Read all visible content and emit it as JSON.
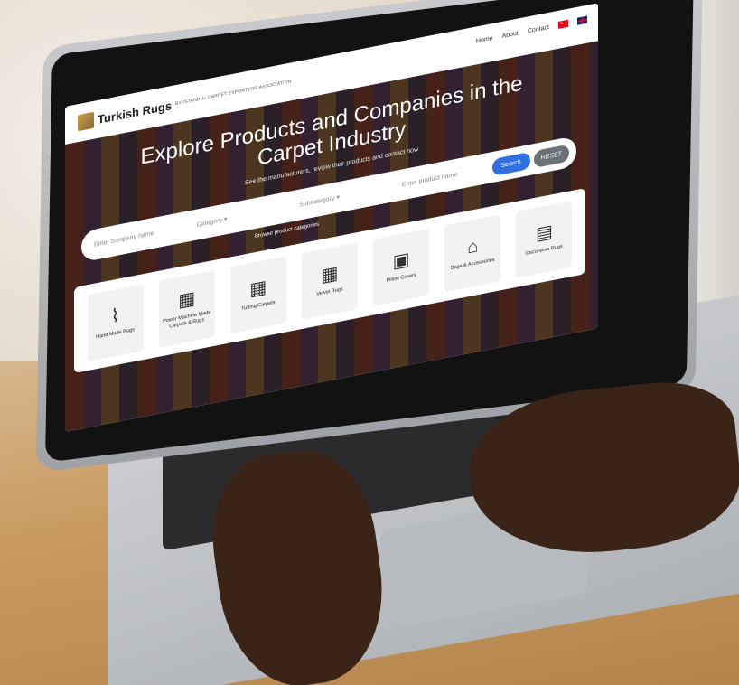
{
  "site": {
    "brand": "Turkish Rugs",
    "brand_sub": "BY ISTANBUL CARPET EXPORTERS ASSOCIATION",
    "nav": [
      "Home",
      "About",
      "Contact"
    ]
  },
  "hero": {
    "title": "Explore Products and Companies in the Carpet Industry",
    "subtitle": "See the manufacturers, review their products and contact now"
  },
  "search": {
    "company_placeholder": "Enter company name",
    "category_label": "Category",
    "subcategory_label": "Subcategory",
    "product_placeholder": "Enter product name",
    "search_label": "Search",
    "reset_label": "RESET",
    "browse_label": "Browse product categories"
  },
  "categories": [
    {
      "label": "Hand Made Rugs",
      "icon": "rolled-rug-icon"
    },
    {
      "label": "Power Machine Made Carpets & Rugs",
      "icon": "rug-icon"
    },
    {
      "label": "Tufting Carpets",
      "icon": "rug-icon"
    },
    {
      "label": "Velvet Rugs",
      "icon": "rug-icon"
    },
    {
      "label": "Pillow Covers",
      "icon": "pillow-icon"
    },
    {
      "label": "Bags & Accessories",
      "icon": "bag-icon"
    },
    {
      "label": "Decorative Rugs",
      "icon": "decorative-rug-icon"
    }
  ]
}
